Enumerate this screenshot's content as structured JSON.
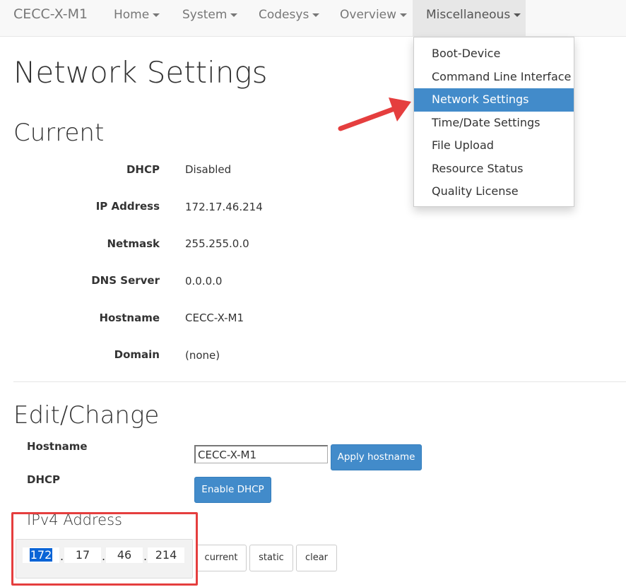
{
  "navbar": {
    "brand": "CECC-X-M1",
    "items": [
      {
        "label": "Home"
      },
      {
        "label": "System"
      },
      {
        "label": "Codesys"
      },
      {
        "label": "Overview"
      },
      {
        "label": "Miscellaneous"
      }
    ]
  },
  "dropdown": {
    "items": [
      {
        "label": "Boot-Device"
      },
      {
        "label": "Command Line Interface"
      },
      {
        "label": "Network Settings"
      },
      {
        "label": "Time/Date Settings"
      },
      {
        "label": "File Upload"
      },
      {
        "label": "Resource Status"
      },
      {
        "label": "Quality License"
      }
    ]
  },
  "page": {
    "title": "Network Settings",
    "current_heading": "Current",
    "edit_heading": "Edit/Change"
  },
  "current": {
    "rows": [
      {
        "label": "DHCP",
        "value": "Disabled"
      },
      {
        "label": "IP Address",
        "value": "172.17.46.214"
      },
      {
        "label": "Netmask",
        "value": "255.255.0.0"
      },
      {
        "label": "DNS Server",
        "value": "0.0.0.0"
      },
      {
        "label": "Hostname",
        "value": "CECC-X-M1"
      },
      {
        "label": "Domain",
        "value": "(none)"
      }
    ]
  },
  "edit": {
    "hostname_label": "Hostname",
    "hostname_value": "CECC-X-M1",
    "apply_hostname": "Apply hostname",
    "dhcp_label": "DHCP",
    "enable_dhcp": "Enable DHCP",
    "ipv4_heading": "IPv4 Address",
    "octets": [
      "172",
      "17",
      "46",
      "214"
    ],
    "dot": ".",
    "btn_current": "current",
    "btn_static": "static",
    "btn_clear": "clear"
  },
  "colors": {
    "primary": "#428bca",
    "annotation_red": "#e53e3e"
  }
}
